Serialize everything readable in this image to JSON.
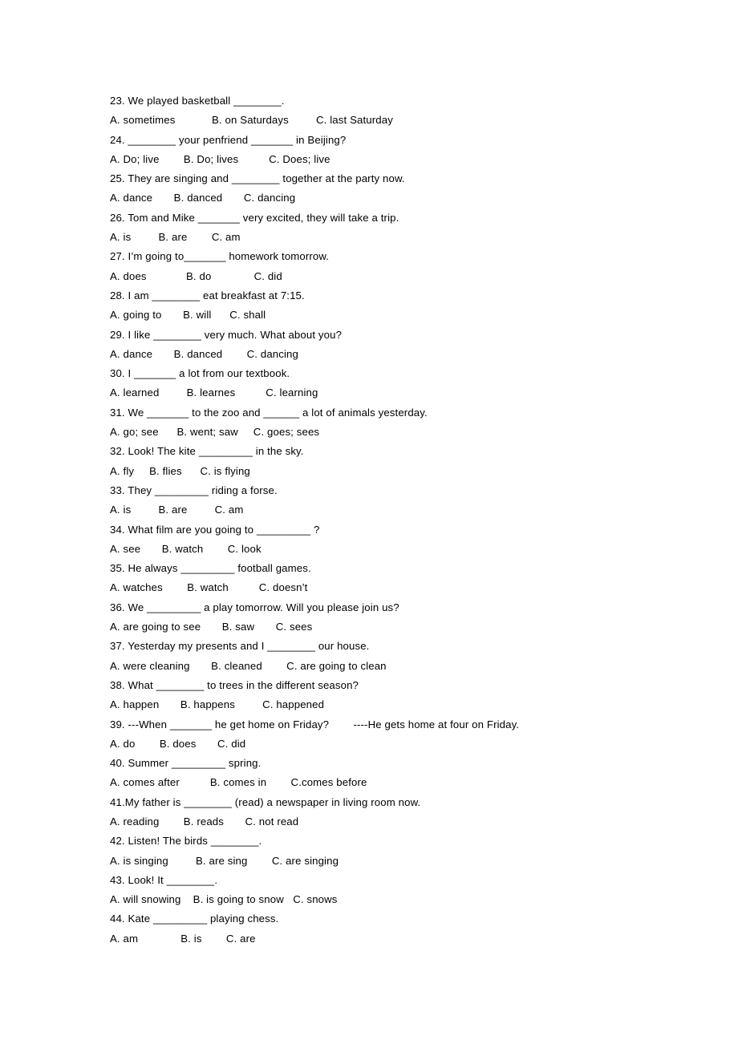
{
  "document": {
    "type": "english-grammar-multiple-choice-worksheet",
    "items": [
      {
        "number": "23",
        "question": "23. We played basketball ________.",
        "options": "A. sometimes            B. on Saturdays         C. last Saturday"
      },
      {
        "number": "24",
        "question": "24. ________ your penfriend _______ in Beijing?",
        "options": "A. Do; live        B. Do; lives          C. Does; live"
      },
      {
        "number": "25",
        "question": "25. They are singing and ________ together at the party now.",
        "options": "A. dance       B. danced       C. dancing"
      },
      {
        "number": "26",
        "question": "26. Tom and Mike _______ very excited, they will take a trip.",
        "options": "A. is         B. are        C. am"
      },
      {
        "number": "27",
        "question": "27. I’m going to_______ homework tomorrow.",
        "options": "A. does             B. do              C. did"
      },
      {
        "number": "28",
        "question": "28. I am ________ eat breakfast at 7:15.",
        "options": "A. going to       B. will      C. shall"
      },
      {
        "number": "29",
        "question": "29. I like ________ very much. What about you?",
        "options": "A. dance       B. danced        C. dancing"
      },
      {
        "number": "30",
        "question": "30. I _______ a lot from our textbook.",
        "options": "A. learned         B. learnes          C. learning"
      },
      {
        "number": "31",
        "question": "31. We _______ to the zoo and ______ a lot of animals yesterday.",
        "options": "A. go; see      B. went; saw     C. goes; sees"
      },
      {
        "number": "32",
        "question": "32. Look! The kite _________ in the sky.",
        "options": "A. fly     B. flies      C. is flying"
      },
      {
        "number": "33",
        "question": "33. They _________ riding a forse.",
        "options": "A. is         B. are         C. am"
      },
      {
        "number": "34",
        "question": "34. What film are you going to _________ ?",
        "options": "A. see       B. watch        C. look"
      },
      {
        "number": "35",
        "question": "35. He always _________ football games.",
        "options": "A. watches        B. watch          C. doesn’t"
      },
      {
        "number": "36",
        "question": "36. We _________ a play tomorrow. Will you please join us?",
        "options": "A. are going to see       B. saw       C. sees"
      },
      {
        "number": "37",
        "question": "37. Yesterday my presents and I ________ our house.",
        "options": "A. were cleaning       B. cleaned        C. are going to clean"
      },
      {
        "number": "38",
        "question": "38. What ________ to trees in the different season?",
        "options": "A. happen       B. happens         C. happened"
      },
      {
        "number": "39",
        "question": "39. ---When _______ he get home on Friday?        ----He gets home at four on Friday.",
        "options": "A. do        B. does       C. did"
      },
      {
        "number": "40",
        "question": "40. Summer _________ spring.",
        "options": "A. comes after          B. comes in        C.comes before"
      },
      {
        "number": "41",
        "question": "41.My father is ________ (read) a newspaper in living room now.",
        "options": "A. reading        B. reads       C. not read"
      },
      {
        "number": "42",
        "question": "42. Listen! The birds ________.",
        "options": "A. is singing         B. are sing        C. are singing"
      },
      {
        "number": "43",
        "question": "43. Look! It ________.",
        "options": "A. will snowing    B. is going to snow   C. snows"
      },
      {
        "number": "44",
        "question": "44. Kate _________ playing chess.",
        "options": "A. am              B. is        C. are"
      }
    ]
  }
}
